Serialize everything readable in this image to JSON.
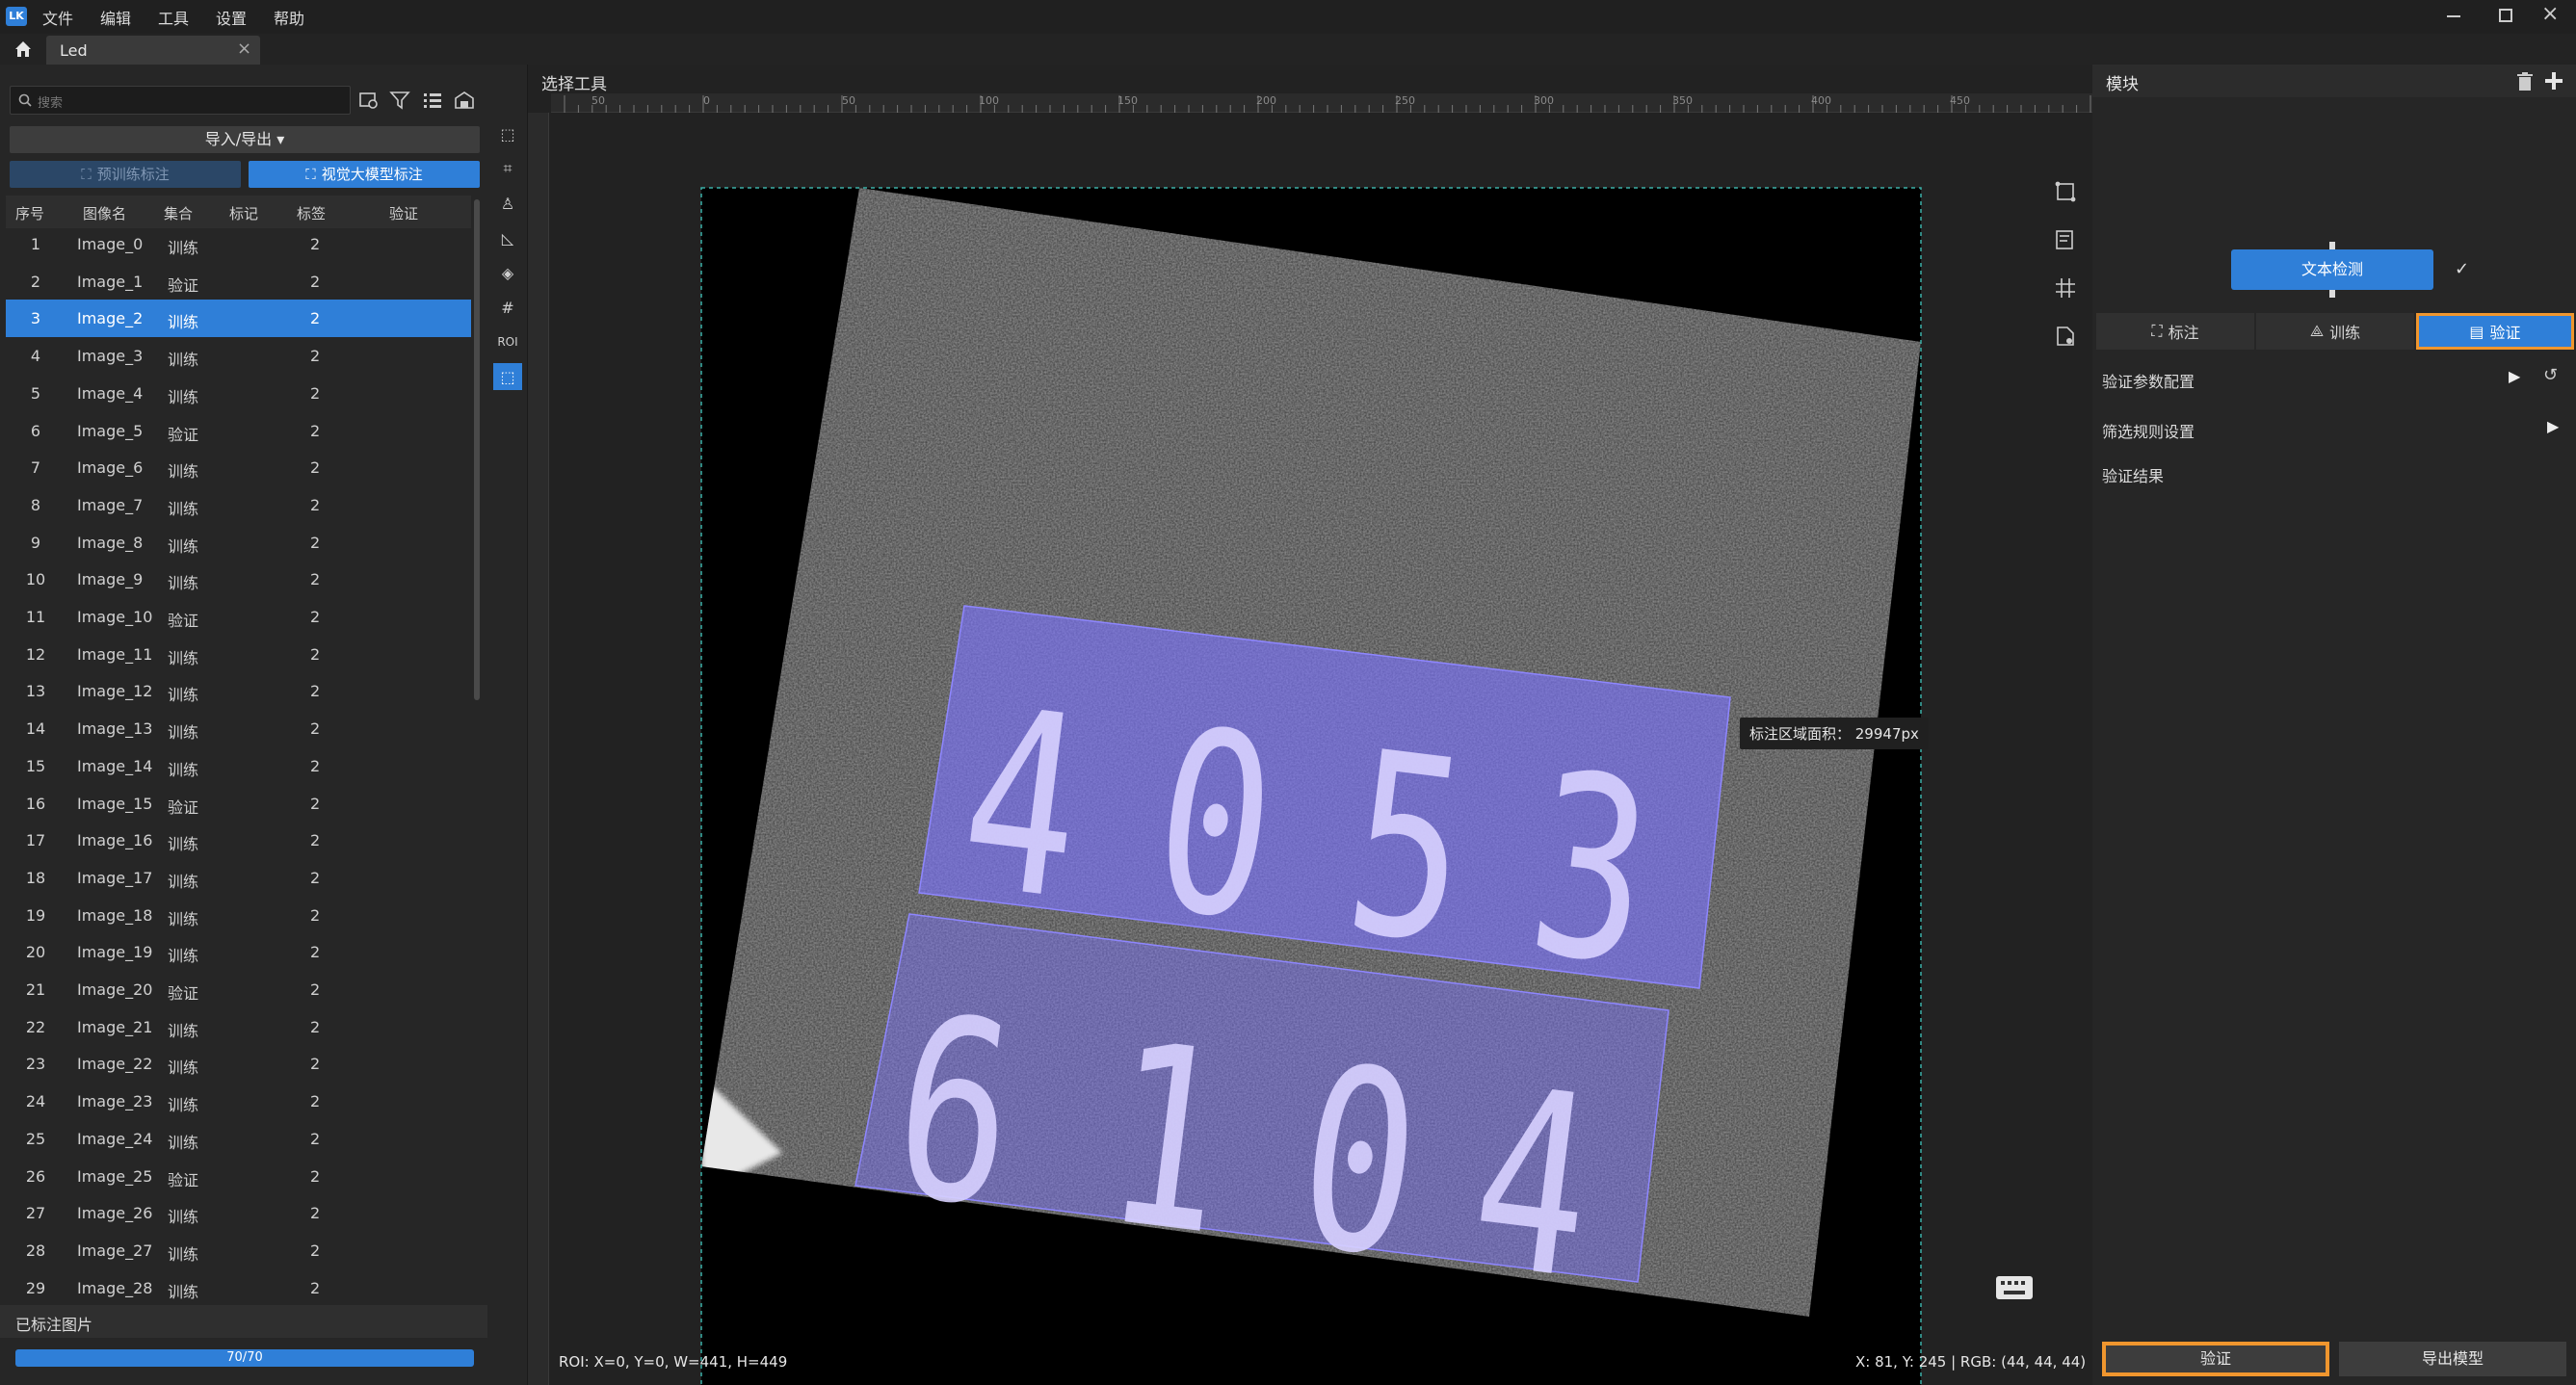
{
  "menu": {
    "logo": "LK",
    "items": [
      "文件",
      "编辑",
      "工具",
      "设置",
      "帮助"
    ]
  },
  "tab": {
    "label": "Led",
    "close": "×"
  },
  "left": {
    "search_placeholder": "搜索",
    "import_export": "导入/导出 ▾",
    "pretrain_label": "预训练标注",
    "vlm_label": "视觉大模型标注",
    "columns": [
      "序号",
      "图像名",
      "集合",
      "标记",
      "标签",
      "验证"
    ],
    "rows": [
      {
        "no": "1",
        "name": "Image_0",
        "set": "训练",
        "tag": "2"
      },
      {
        "no": "2",
        "name": "Image_1",
        "set": "验证",
        "tag": "2"
      },
      {
        "no": "3",
        "name": "Image_2",
        "set": "训练",
        "tag": "2"
      },
      {
        "no": "4",
        "name": "Image_3",
        "set": "训练",
        "tag": "2"
      },
      {
        "no": "5",
        "name": "Image_4",
        "set": "训练",
        "tag": "2"
      },
      {
        "no": "6",
        "name": "Image_5",
        "set": "验证",
        "tag": "2"
      },
      {
        "no": "7",
        "name": "Image_6",
        "set": "训练",
        "tag": "2"
      },
      {
        "no": "8",
        "name": "Image_7",
        "set": "训练",
        "tag": "2"
      },
      {
        "no": "9",
        "name": "Image_8",
        "set": "训练",
        "tag": "2"
      },
      {
        "no": "10",
        "name": "Image_9",
        "set": "训练",
        "tag": "2"
      },
      {
        "no": "11",
        "name": "Image_10",
        "set": "验证",
        "tag": "2"
      },
      {
        "no": "12",
        "name": "Image_11",
        "set": "训练",
        "tag": "2"
      },
      {
        "no": "13",
        "name": "Image_12",
        "set": "训练",
        "tag": "2"
      },
      {
        "no": "14",
        "name": "Image_13",
        "set": "训练",
        "tag": "2"
      },
      {
        "no": "15",
        "name": "Image_14",
        "set": "训练",
        "tag": "2"
      },
      {
        "no": "16",
        "name": "Image_15",
        "set": "验证",
        "tag": "2"
      },
      {
        "no": "17",
        "name": "Image_16",
        "set": "训练",
        "tag": "2"
      },
      {
        "no": "18",
        "name": "Image_17",
        "set": "训练",
        "tag": "2"
      },
      {
        "no": "19",
        "name": "Image_18",
        "set": "训练",
        "tag": "2"
      },
      {
        "no": "20",
        "name": "Image_19",
        "set": "训练",
        "tag": "2"
      },
      {
        "no": "21",
        "name": "Image_20",
        "set": "验证",
        "tag": "2"
      },
      {
        "no": "22",
        "name": "Image_21",
        "set": "训练",
        "tag": "2"
      },
      {
        "no": "23",
        "name": "Image_22",
        "set": "训练",
        "tag": "2"
      },
      {
        "no": "24",
        "name": "Image_23",
        "set": "训练",
        "tag": "2"
      },
      {
        "no": "25",
        "name": "Image_24",
        "set": "训练",
        "tag": "2"
      },
      {
        "no": "26",
        "name": "Image_25",
        "set": "验证",
        "tag": "2"
      },
      {
        "no": "27",
        "name": "Image_26",
        "set": "训练",
        "tag": "2"
      },
      {
        "no": "28",
        "name": "Image_27",
        "set": "训练",
        "tag": "2"
      },
      {
        "no": "29",
        "name": "Image_28",
        "set": "训练",
        "tag": "2"
      }
    ],
    "selected_row": "3",
    "annotated_label": "已标注图片",
    "progress_text": "70/70",
    "progress_fraction": 1.0
  },
  "canvas": {
    "title": "选择工具",
    "ruler_labels": [
      "50",
      "0",
      "50",
      "100",
      "150",
      "200",
      "250",
      "300",
      "350",
      "400",
      "450"
    ],
    "area_tooltip": "标注区域面积： 29947px",
    "roi_status": "ROI: X=0, Y=0, W=441, H=449",
    "pixel_status": "X: 81, Y: 245 | RGB: (44, 44, 44)",
    "digits_top": [
      "4",
      "0",
      "5",
      "3"
    ],
    "digits_bottom": [
      "6",
      "1",
      "0",
      "4"
    ]
  },
  "right": {
    "title": "模块",
    "node_label": "文本检测",
    "tabs": [
      "标注",
      "训练",
      "验证"
    ],
    "active_tab": "验证",
    "sections": [
      "验证参数配置",
      "筛选规则设置",
      "验证结果"
    ],
    "verify_button": "验证",
    "export_button": "导出模型"
  },
  "colors": {
    "accent": "#2f7fd8",
    "highlight": "#f0962e",
    "annotation": "#7b72ff"
  }
}
